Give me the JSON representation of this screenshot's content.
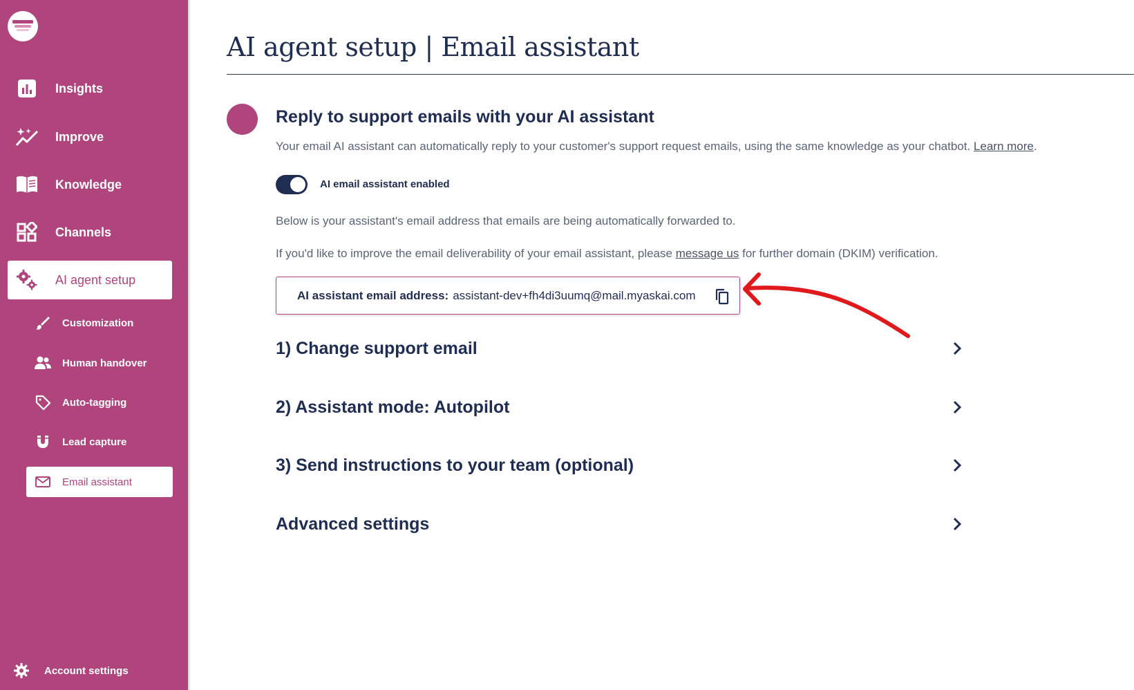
{
  "sidebar": {
    "nav": [
      {
        "label": "Insights",
        "icon": "bar-chart-icon",
        "active": false
      },
      {
        "label": "Improve",
        "icon": "sparkle-chart-icon",
        "active": false
      },
      {
        "label": "Knowledge",
        "icon": "book-icon",
        "active": false
      },
      {
        "label": "Channels",
        "icon": "widgets-icon",
        "active": false
      },
      {
        "label": "AI agent setup",
        "icon": "gears-icon",
        "active": true
      }
    ],
    "sub_items": [
      {
        "label": "Customization",
        "icon": "brush-icon",
        "active": false
      },
      {
        "label": "Human handover",
        "icon": "people-icon",
        "active": false
      },
      {
        "label": "Auto-tagging",
        "icon": "tag-icon",
        "active": false
      },
      {
        "label": "Lead capture",
        "icon": "magnet-icon",
        "active": false
      },
      {
        "label": "Email assistant",
        "icon": "envelope-icon",
        "active": true
      }
    ],
    "account_label": "Account settings"
  },
  "page": {
    "title": "AI agent setup | Email assistant"
  },
  "section": {
    "heading": "Reply to support emails with your AI assistant",
    "description": "Your email AI assistant can automatically reply to your customer's support request emails, using the same knowledge as your chatbot.",
    "learn_more": "Learn more",
    "description_end": ".",
    "toggle_label": "AI email assistant enabled",
    "toggle_on": true,
    "forward_note": "Below is your assistant's email address that emails are being automatically forwarded to.",
    "dkim_note_before": "If you'd like to improve the email deliverability of your email assistant, please",
    "dkim_link": "message us",
    "dkim_note_after": "for further domain (DKIM) verification.",
    "email_label": "AI assistant email address:",
    "email_value": "assistant-dev+fh4di3uumq@mail.myaskai.com"
  },
  "accordions": [
    {
      "label": "1) Change support email"
    },
    {
      "label": "2) Assistant mode: Autopilot"
    },
    {
      "label": "3) Send instructions to your team (optional)"
    },
    {
      "label": "Advanced settings"
    }
  ],
  "colors": {
    "brand": "#b0457e",
    "navy": "#1f2d52",
    "annotation": "#e0191d"
  }
}
